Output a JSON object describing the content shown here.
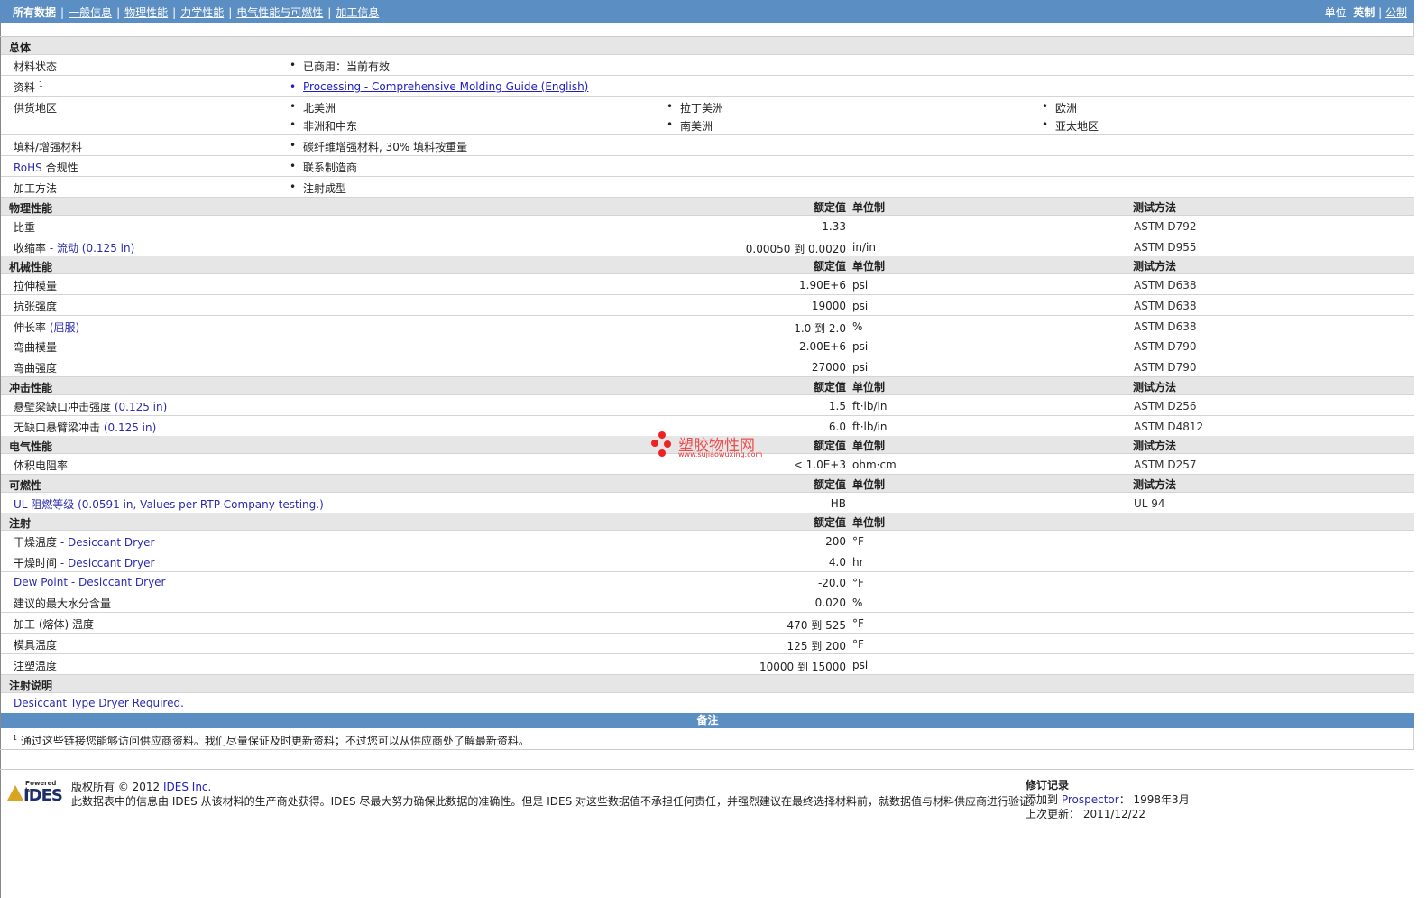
{
  "nav": {
    "current": "所有数据",
    "links": [
      "一般信息",
      "物理性能",
      "力学性能",
      "电气性能与可燃性",
      "加工信息"
    ]
  },
  "units": {
    "label": "单位",
    "current": "英制",
    "other": "公制"
  },
  "general": {
    "title": "总体",
    "status_label": "材料状态",
    "status_value": "已商用：当前有效",
    "docs_label": "资料",
    "docs_sup": "1",
    "docs_link": "Processing - Comprehensive Molding Guide (English)",
    "regions_label": "供货地区",
    "regions": [
      "北美洲",
      "拉丁美洲",
      "欧洲",
      "非洲和中东",
      "南美洲",
      "亚太地区"
    ],
    "filler_label": "填料/增强材料",
    "filler_value": "碳纤维增强材料, 30% 填料按重量",
    "rohs_label_a": "RoHS",
    "rohs_label_b": " 合规性",
    "rohs_value": "联系制造商",
    "process_label": "加工方法",
    "process_value": "注射成型"
  },
  "headers": {
    "nominal": "额定值",
    "unit": "单位制",
    "method": "测试方法"
  },
  "sections": {
    "physical": "物理性能",
    "mechanical": "机械性能",
    "impact": "冲击性能",
    "electrical": "电气性能",
    "flammability": "可燃性",
    "injection": "注射",
    "injection_notes": "注射说明"
  },
  "physical_rows": [
    {
      "label": "比重",
      "sub": "",
      "value": "1.33",
      "unit": "",
      "method": "ASTM D792"
    },
    {
      "label": "收缩率",
      "sub": " - 流动 (0.125 in)",
      "value": "0.00050 到  0.0020",
      "unit": "in/in",
      "method": "ASTM D955"
    }
  ],
  "mechanical_rows": [
    {
      "label": "拉伸模量",
      "sub": "",
      "value": "1.90E+6",
      "unit": "psi",
      "method": "ASTM D638"
    },
    {
      "label": "抗张强度",
      "sub": "",
      "value": "19000",
      "unit": "psi",
      "method": "ASTM D638"
    },
    {
      "label": "伸长率",
      "sub": " (屈服)",
      "value": "1.0 到  2.0",
      "unit": "%",
      "method": "ASTM D638"
    },
    {
      "label": "弯曲模量",
      "sub": "",
      "value": "2.00E+6",
      "unit": "psi",
      "method": "ASTM D790"
    },
    {
      "label": "弯曲强度",
      "sub": "",
      "value": "27000",
      "unit": "psi",
      "method": "ASTM D790"
    }
  ],
  "impact_rows": [
    {
      "label": "悬壁梁缺口冲击强度",
      "sub": " (0.125 in)",
      "value": "1.5",
      "unit": "ft·lb/in",
      "method": "ASTM D256"
    },
    {
      "label": "无缺口悬臂梁冲击",
      "sub": " (0.125 in)",
      "value": "6.0",
      "unit": "ft·lb/in",
      "method": "ASTM D4812"
    }
  ],
  "electrical_rows": [
    {
      "label": "体积电阻率",
      "sub": "",
      "value": "< 1.0E+3",
      "unit": "ohm·cm",
      "method": "ASTM D257"
    }
  ],
  "flammability_rows": [
    {
      "label": "UL 阻燃等级",
      "sub": " (0.0591 in, Values per RTP Company testing.)",
      "value": "HB",
      "unit": "",
      "method": "UL 94"
    }
  ],
  "injection_rows": [
    {
      "label": "干燥温度",
      "sub": " - Desiccant Dryer",
      "value": "200",
      "unit": "°F"
    },
    {
      "label": "干燥时间",
      "sub": " - Desiccant Dryer",
      "value": "4.0",
      "unit": "hr"
    },
    {
      "label": "Dew Point - Desiccant Dryer",
      "sub": "",
      "value": "-20.0",
      "unit": "°F"
    },
    {
      "label": "建议的最大水分含量",
      "sub": "",
      "value": "0.020",
      "unit": "%"
    },
    {
      "label": "加工 (熔体) 温度",
      "sub": "",
      "value": "470 到  525",
      "unit": "°F"
    },
    {
      "label": "模具温度",
      "sub": "",
      "value": "125 到  200",
      "unit": "°F"
    },
    {
      "label": "注塑温度",
      "sub": "",
      "value": "10000 到  15000",
      "unit": "psi"
    }
  ],
  "injection_note_text": "Desiccant Type Dryer Required.",
  "notes": {
    "title": "备注",
    "sup": "1",
    "text": "通过这些链接您能够访问供应商资料。我们尽量保证及时更新资料；不过您可以从供应商处了解最新资料。"
  },
  "footer": {
    "powered_by": "Powered by",
    "logo": "IDES",
    "copyright_a": "版权所有 © 2012 ",
    "copyright_link": "IDES Inc.",
    "disclaimer": "此数据表中的信息由 IDES 从该材料的生产商处获得。IDES 尽最大努力确保此数据的准确性。但是 IDES 对这些数据值不承担任何责任，并强烈建议在最终选择材料前，就数据值与材料供应商进行验证。",
    "rev_title": "修订记录",
    "added_label": "添加到 ",
    "added_src": "Prospector",
    "added_date": "：  1998年3月",
    "updated_label": "上次更新：",
    "updated_date": "  2011/12/22"
  },
  "watermark": {
    "text": "塑胶物性网",
    "url": "www.sujiaowuxing.com"
  }
}
